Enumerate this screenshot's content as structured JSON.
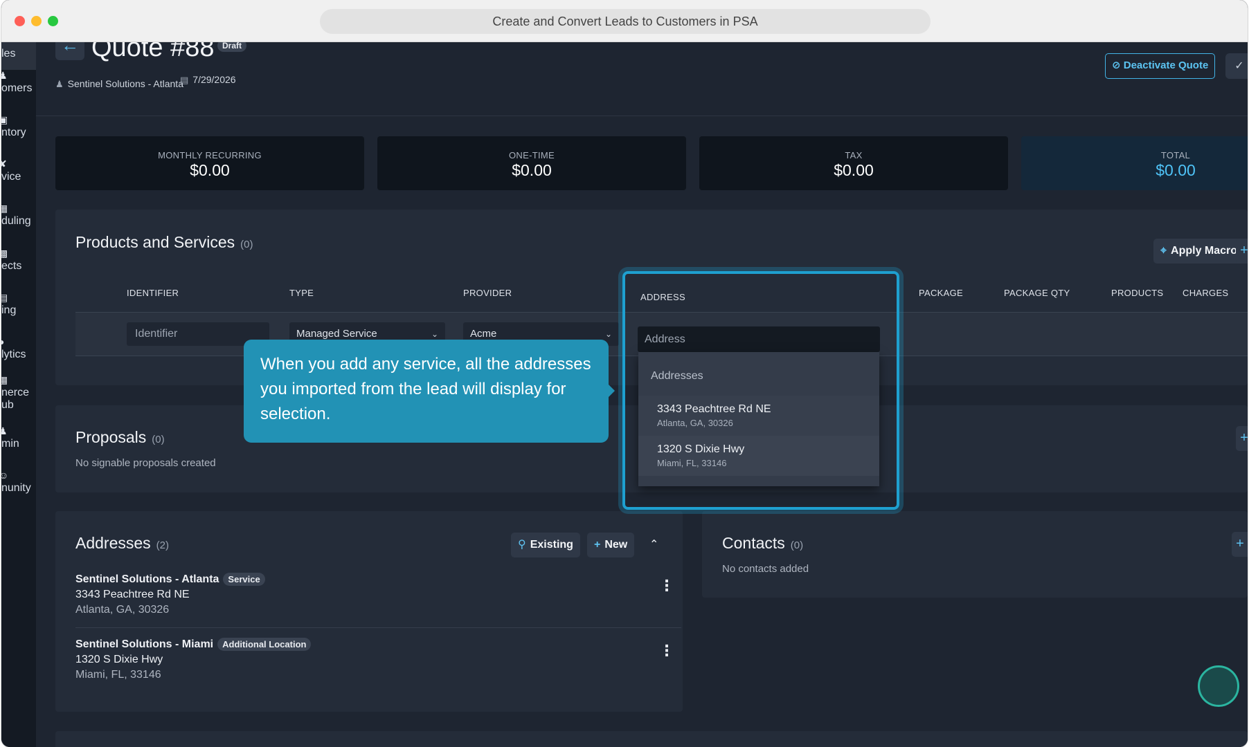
{
  "browser": {
    "title": "Create and Convert Leads to Customers in PSA"
  },
  "sidebar": {
    "items": [
      {
        "label": "les",
        "icon": ""
      },
      {
        "label": "omers",
        "icon": "users-icon"
      },
      {
        "label": "ntory",
        "icon": "box-icon"
      },
      {
        "label": "vice",
        "icon": "wrench-icon"
      },
      {
        "label": "duling",
        "icon": "calendar-icon"
      },
      {
        "label": "ects",
        "icon": "grid-icon"
      },
      {
        "label": "ing",
        "icon": "invoice-icon"
      },
      {
        "label": "lytics",
        "icon": "pie-icon"
      },
      {
        "label": "nerce",
        "label2": "ub",
        "icon": "store-icon"
      },
      {
        "label": "min",
        "icon": "user-admin-icon"
      },
      {
        "label": "nunity",
        "icon": "community-icon"
      }
    ]
  },
  "header": {
    "title": "Quote #88",
    "status": "Draft",
    "company": "Sentinel Solutions - Atlanta",
    "date": "7/29/2026",
    "deactivate_label": "Deactivate Quote"
  },
  "totals": [
    {
      "label": "MONTHLY RECURRING",
      "value": "$0.00"
    },
    {
      "label": "ONE-TIME",
      "value": "$0.00"
    },
    {
      "label": "TAX",
      "value": "$0.00"
    },
    {
      "label": "TOTAL",
      "value": "$0.00"
    }
  ],
  "products": {
    "title": "Products and Services",
    "count": "(0)",
    "apply_macro": "Apply Macro",
    "columns": [
      "IDENTIFIER",
      "TYPE",
      "PROVIDER",
      "ADDRESS",
      "PACKAGE",
      "PACKAGE QTY",
      "PRODUCTS",
      "CHARGES"
    ],
    "row": {
      "identifier_placeholder": "Identifier",
      "type": "Managed Service",
      "provider": "Acme",
      "address_placeholder": "Address"
    },
    "dropdown": {
      "header": "Addresses",
      "options": [
        {
          "street": "3343 Peachtree Rd NE",
          "city": "Atlanta, GA, 30326"
        },
        {
          "street": "1320 S Dixie Hwy",
          "city": "Miami, FL, 33146"
        }
      ]
    }
  },
  "tooltip": {
    "text": "When you add any service, all the addresses you imported from the lead will display for selection."
  },
  "proposals": {
    "title": "Proposals",
    "count": "(0)",
    "empty": "No signable proposals created"
  },
  "addresses": {
    "title": "Addresses",
    "count": "(2)",
    "existing_label": "Existing",
    "new_label": "New",
    "items": [
      {
        "name": "Sentinel Solutions - Atlanta",
        "badge": "Service",
        "street": "3343 Peachtree Rd NE",
        "city": "Atlanta, GA, 30326"
      },
      {
        "name": "Sentinel Solutions - Miami",
        "badge": "Additional Location",
        "street": "1320 S Dixie Hwy",
        "city": "Miami, FL, 33146"
      }
    ]
  },
  "contacts": {
    "title": "Contacts",
    "count": "(0)",
    "empty": "No contacts added"
  },
  "colors": {
    "accent": "#4fc3f7",
    "tooltip": "#2292b5",
    "highlight": "#1ea0d0"
  }
}
